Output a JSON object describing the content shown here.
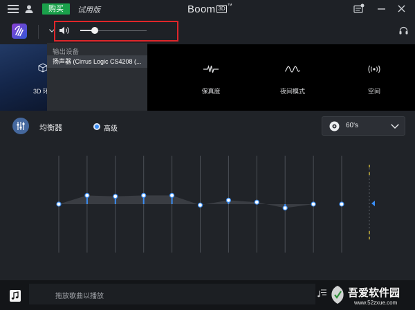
{
  "titlebar": {
    "buy_label": "购买",
    "trial_label": "试用版",
    "brand": {
      "name": "Boom",
      "mark": "3D",
      "tm": "™"
    }
  },
  "toolbar": {
    "volume_level": 0.22
  },
  "output_menu": {
    "heading": "输出设备",
    "items": [
      {
        "label": "扬声器 (Cirrus Logic CS4208 (...",
        "selected": true
      }
    ]
  },
  "effects": [
    {
      "label": "3D 环",
      "icon": "cube-icon"
    },
    {
      "label": "保真度",
      "icon": "fidelity-wave-icon"
    },
    {
      "label": "夜间模式",
      "icon": "night-mode-wave-icon"
    },
    {
      "label": "空间",
      "icon": "ambience-icon"
    }
  ],
  "equalizer": {
    "title": "均衡器",
    "mode_label": "高级",
    "mode_selected": true,
    "preset": "60's",
    "band_levels": [
      0.5,
      0.59,
      0.58,
      0.59,
      0.59,
      0.49,
      0.54,
      0.52,
      0.46,
      0.5,
      0.5
    ],
    "preamp_level": 0.5
  },
  "player": {
    "drop_hint": "拖放歌曲以播放"
  },
  "watermark": {
    "name": "吾爱软件园",
    "url": "www.52zxue.com"
  },
  "colors": {
    "accent": "#3a8ef6",
    "buy_button": "#1aa14b",
    "highlight_box": "#e0262a",
    "preamp_marks": "#c9b33a"
  }
}
